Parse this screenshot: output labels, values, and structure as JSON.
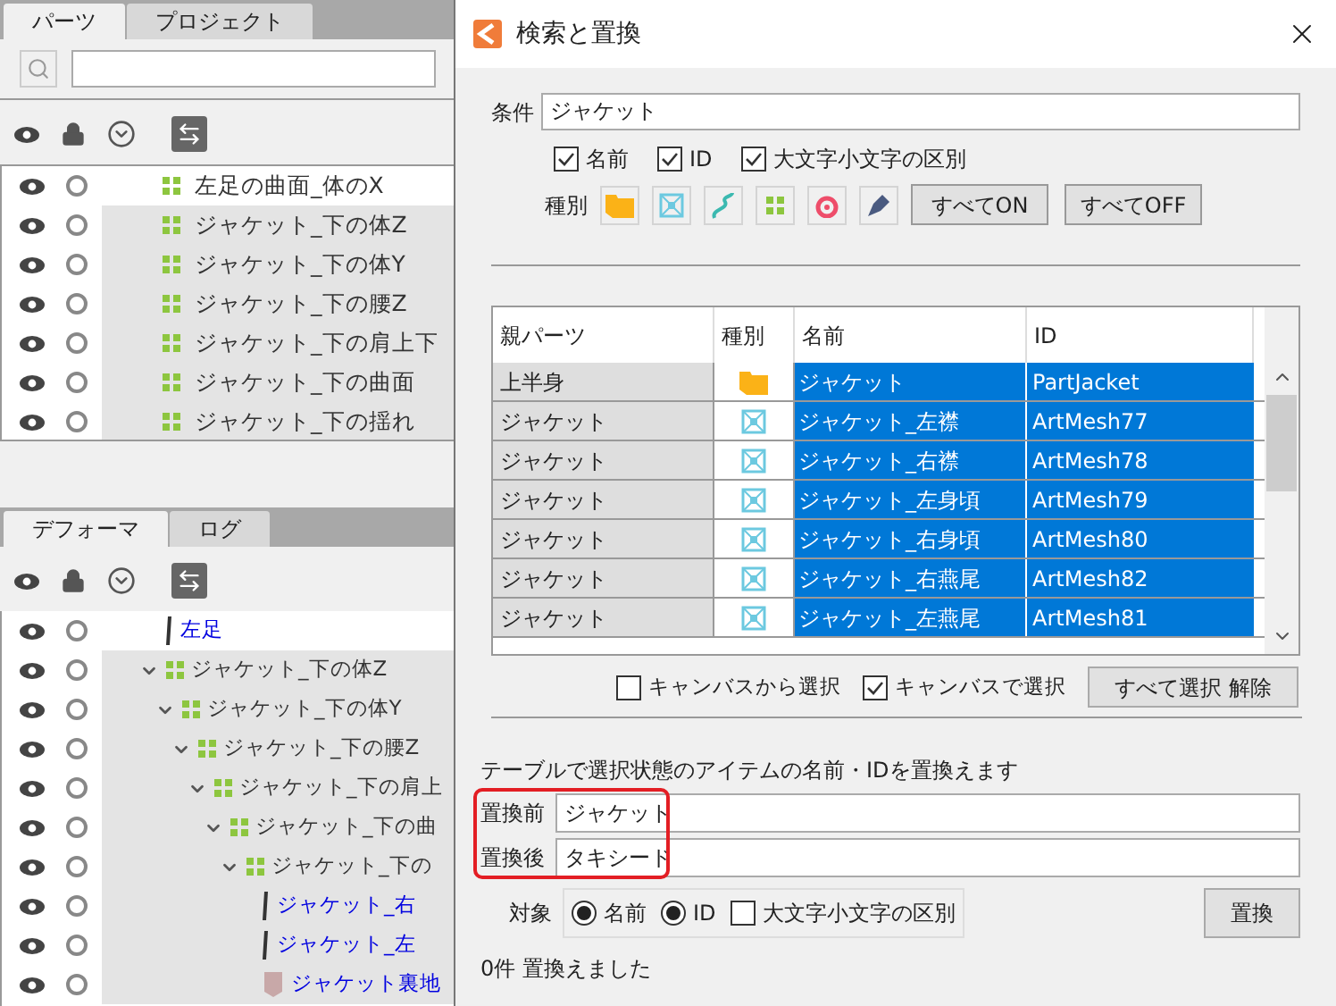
{
  "parts_panel": {
    "tabs": [
      {
        "label": "パーツ",
        "selected": true
      },
      {
        "label": "プロジェクト",
        "selected": false
      }
    ],
    "rows": [
      {
        "name": "左足の曲面_体のX",
        "selected": false
      },
      {
        "name": "ジャケット_下の体Z",
        "selected": true
      },
      {
        "name": "ジャケット_下の体Y",
        "selected": true
      },
      {
        "name": "ジャケット_下の腰Z",
        "selected": true
      },
      {
        "name": "ジャケット_下の肩上下",
        "selected": true
      },
      {
        "name": "ジャケット_下の曲面",
        "selected": true
      },
      {
        "name": "ジャケット_下の揺れ",
        "selected": true
      }
    ]
  },
  "deformer_panel": {
    "tabs": [
      {
        "label": "デフォーマ",
        "selected": true
      },
      {
        "label": "ログ",
        "selected": false
      }
    ],
    "tree": [
      {
        "name": "左足",
        "kind": "line",
        "selected": false
      },
      {
        "name": "ジャケット_下の体Z",
        "kind": "deformer",
        "selected": true,
        "expanded": true,
        "children": [
          {
            "name": "ジャケット_下の体Y",
            "kind": "deformer",
            "selected": true,
            "expanded": true,
            "children": [
              {
                "name": "ジャケット_下の腰Z",
                "kind": "deformer",
                "selected": true,
                "expanded": true,
                "children": [
                  {
                    "name": "ジャケット_下の肩上",
                    "kind": "deformer",
                    "selected": true,
                    "expanded": true,
                    "children": [
                      {
                        "name": "ジャケット_下の曲",
                        "kind": "deformer",
                        "selected": true,
                        "expanded": true,
                        "children": [
                          {
                            "name": "ジャケット_下の",
                            "kind": "deformer",
                            "selected": true,
                            "expanded": true,
                            "children": [
                              {
                                "name": "ジャケット_右",
                                "kind": "line",
                                "selected": true
                              },
                              {
                                "name": "ジャケット_左",
                                "kind": "line",
                                "selected": true
                              },
                              {
                                "name": "ジャケット裏地",
                                "kind": "shape",
                                "selected": true
                              }
                            ]
                          }
                        ]
                      }
                    ]
                  }
                ]
              }
            ]
          }
        ]
      }
    ]
  },
  "dialog": {
    "title": "検索と置換",
    "condition": {
      "label": "条件",
      "value": "ジャケット"
    },
    "match_options": [
      {
        "label": "名前",
        "checked": true
      },
      {
        "label": "ID",
        "checked": true
      },
      {
        "label": "大文字小文字の区別",
        "checked": true
      }
    ],
    "type_label": "種別",
    "type_filters": [
      {
        "kind": "part"
      },
      {
        "kind": "mesh"
      },
      {
        "kind": "curve"
      },
      {
        "kind": "deformer"
      },
      {
        "kind": "rotation"
      },
      {
        "kind": "pen"
      }
    ],
    "type_buttons": [
      "すべてON",
      "すべてOFF"
    ],
    "table": {
      "columns": [
        "親パーツ",
        "種別",
        "名前",
        "ID"
      ],
      "rows": [
        {
          "parent": "上半身",
          "kind": "part",
          "name": "ジャケット",
          "id": "PartJacket",
          "selected": true
        },
        {
          "parent": "ジャケット",
          "kind": "mesh",
          "name": "ジャケット_左襟",
          "id": "ArtMesh77",
          "selected": true
        },
        {
          "parent": "ジャケット",
          "kind": "mesh",
          "name": "ジャケット_右襟",
          "id": "ArtMesh78",
          "selected": true
        },
        {
          "parent": "ジャケット",
          "kind": "mesh",
          "name": "ジャケット_左身頃",
          "id": "ArtMesh79",
          "selected": true
        },
        {
          "parent": "ジャケット",
          "kind": "mesh",
          "name": "ジャケット_右身頃",
          "id": "ArtMesh80",
          "selected": true
        },
        {
          "parent": "ジャケット",
          "kind": "mesh",
          "name": "ジャケット_右燕尾",
          "id": "ArtMesh82",
          "selected": true
        },
        {
          "parent": "ジャケット",
          "kind": "mesh",
          "name": "ジャケット_左燕尾",
          "id": "ArtMesh81",
          "selected": true
        }
      ]
    },
    "canvas_options": [
      {
        "label": "キャンバスから選択",
        "checked": false
      },
      {
        "label": "キャンバスで選択",
        "checked": true
      }
    ],
    "deselect_button": "すべて選択 解除",
    "description": "テーブルで選択状態のアイテムの名前・IDを置換えます",
    "before": {
      "label": "置換前",
      "value": "ジャケット"
    },
    "after": {
      "label": "置換後",
      "value": "タキシード"
    },
    "target_label": "対象",
    "target_options": [
      {
        "label": "名前",
        "kind": "radio",
        "selected": true
      },
      {
        "label": "ID",
        "kind": "radio",
        "selected": true
      },
      {
        "label": "大文字小文字の区別",
        "kind": "checkbox",
        "checked": false
      }
    ],
    "replace_button": "置換",
    "status": "0件 置換えました"
  }
}
